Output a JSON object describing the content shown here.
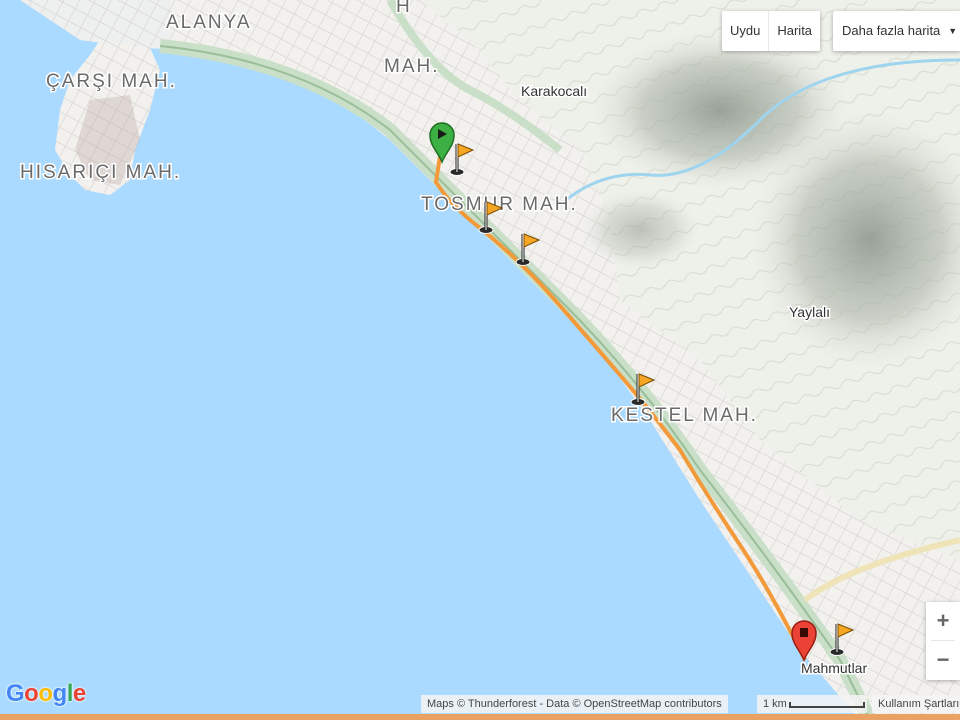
{
  "map_type": {
    "satellite_label": "Uydu",
    "map_label": "Harita",
    "more_maps_label": "Daha fazla harita",
    "active": "Harita"
  },
  "places": {
    "alanya": "ALANYA",
    "carsi": "ÇARŞI MAH.",
    "hisarici": "HISARIÇI MAH.",
    "mah_partial": "MAH.",
    "h_partial": "H",
    "karakocali": "Karakocalı",
    "tosmur": "TOSMUR MAH.",
    "yaylali": "Yaylalı",
    "kestel": "KESTEL MAH.",
    "mahmutlar": "Mahmutlar"
  },
  "route": {
    "color": "#f29a3a",
    "start_marker_color": "#3cb043",
    "end_marker_color": "#ea4335",
    "flag_color": "#f5a623",
    "waypoint_count": 6
  },
  "zoom": {
    "in_label": "+",
    "out_label": "−"
  },
  "footer": {
    "logo": "Google",
    "attribution": "Maps © Thunderforest - Data © OpenStreetMap contributors",
    "scale_label": "1 km",
    "terms_label": "Kullanım Şartları"
  },
  "colors": {
    "sea": "#aadaff",
    "land": "#f3f1ec",
    "road_main": "#c9dfc7",
    "river": "#9fd4ef"
  }
}
